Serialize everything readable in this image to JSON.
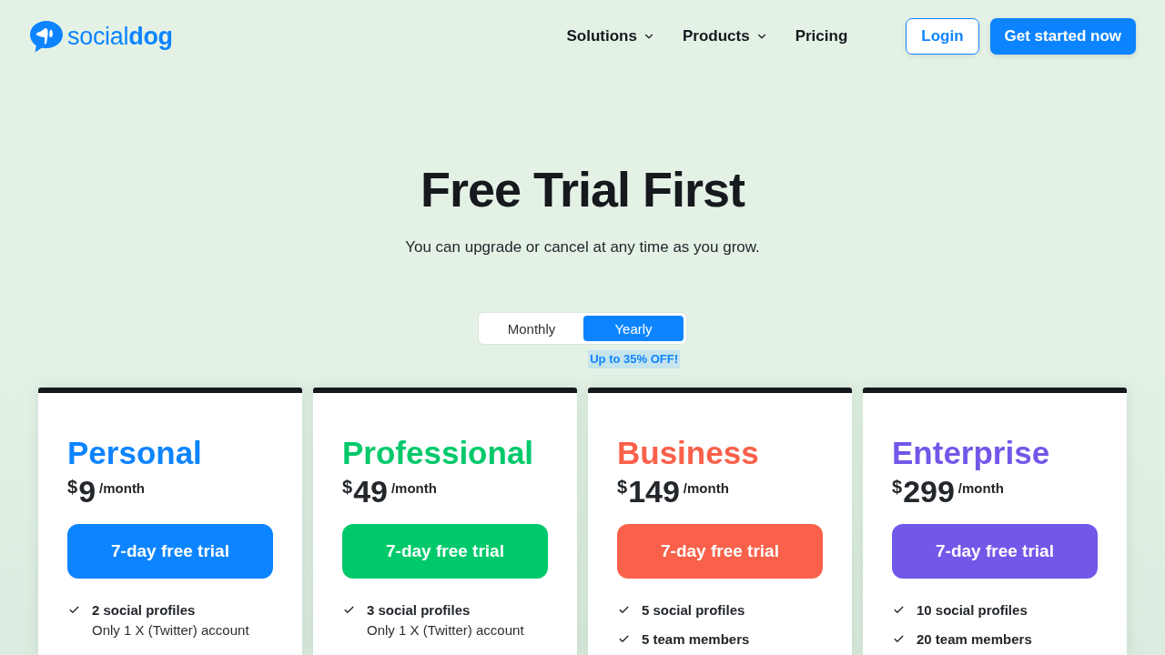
{
  "header": {
    "logo": "social**dog**",
    "nav": [
      {
        "label": "Solutions",
        "dropdown": true
      },
      {
        "label": "Products",
        "dropdown": true
      },
      {
        "label": "Pricing",
        "dropdown": false
      }
    ],
    "login": "Login",
    "cta": "Get started now"
  },
  "hero": {
    "title": "Free Trial First",
    "subtitle": "You can upgrade or cancel at any time as you grow."
  },
  "billing": {
    "options": [
      {
        "label": "Monthly",
        "selected": false
      },
      {
        "label": "Yearly",
        "selected": true
      }
    ],
    "badge": "Up to 35% OFF!"
  },
  "plans": [
    {
      "name": "Personal",
      "color": "#0d84ff",
      "currency": "$",
      "price": "9",
      "period": "/month",
      "button": "7-day free trial",
      "features": [
        {
          "text": "2 social profiles",
          "note": "Only 1 X (Twitter) account"
        }
      ]
    },
    {
      "name": "Professional",
      "color": "#00c96b",
      "currency": "$",
      "price": "49",
      "period": "/month",
      "button": "7-day free trial",
      "features": [
        {
          "text": "3 social profiles",
          "note": "Only 1 X (Twitter) account"
        }
      ]
    },
    {
      "name": "Business",
      "color": "#f9614a",
      "currency": "$",
      "price": "149",
      "period": "/month",
      "button": "7-day free trial",
      "features": [
        {
          "text": "5 social profiles"
        },
        {
          "text": "5 team members"
        }
      ]
    },
    {
      "name": "Enterprise",
      "color": "#7357e8",
      "currency": "$",
      "price": "299",
      "period": "/month",
      "button": "7-day free trial",
      "features": [
        {
          "text": "10 social profiles"
        },
        {
          "text": "20 team members"
        }
      ]
    }
  ]
}
